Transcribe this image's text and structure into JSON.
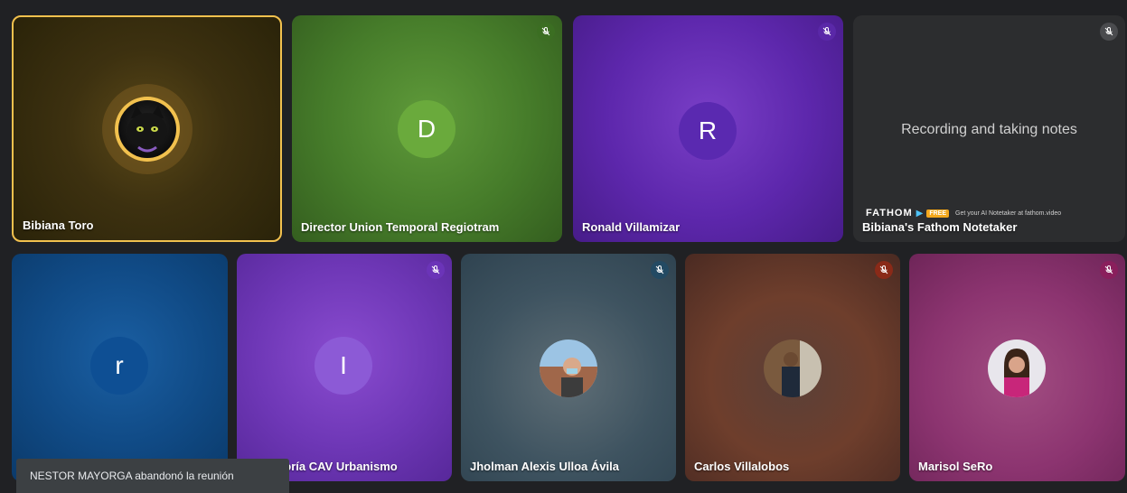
{
  "participants": [
    {
      "name": "Bibiana Toro",
      "avatar": "photo-cat"
    },
    {
      "name": "Director Union Temporal Regiotram",
      "avatar": "D",
      "mic": "muted"
    },
    {
      "name": "Ronald Villamizar",
      "avatar": "R",
      "mic": "muted"
    },
    {
      "name": "Bibiana's Fathom Notetaker",
      "status_text": "Recording and taking notes",
      "mic": "muted"
    },
    {
      "name": "",
      "avatar": "r"
    },
    {
      "name": "ntoría CAV Urbanismo",
      "avatar": "I",
      "mic": "muted"
    },
    {
      "name": "Jholman Alexis Ulloa Ávila",
      "avatar": "photo",
      "mic": "muted"
    },
    {
      "name": "Carlos Villalobos",
      "avatar": "photo",
      "mic": "muted"
    },
    {
      "name": "Marisol SeRo",
      "avatar": "photo",
      "mic": "muted"
    }
  ],
  "fathom": {
    "logo": "FATHOM",
    "badge": "FREE",
    "promo": "Get your AI Notetaker at fathom.video"
  },
  "toast": {
    "text": "NESTOR MAYORGA abandonó la reunión"
  },
  "colors": {
    "active_speaker_border": "#f2c14e"
  }
}
